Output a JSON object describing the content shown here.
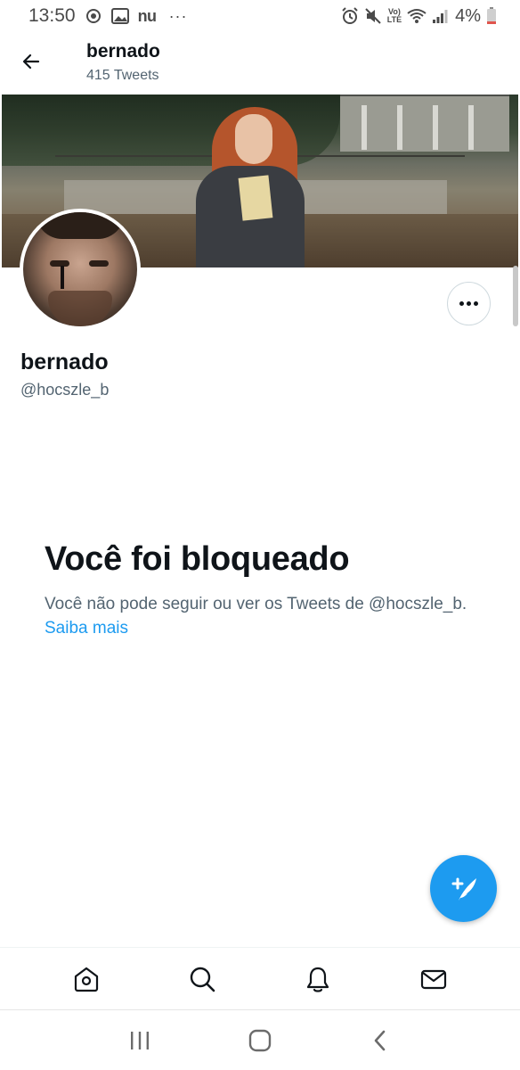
{
  "status_bar": {
    "time": "13:50",
    "carrier_text": "nu",
    "more_indicator": "···",
    "lte_top": "Vo)",
    "lte_bottom": "LTE",
    "battery_percent": "4%",
    "icons": [
      "sync-icon",
      "image-icon",
      "alarm-icon",
      "mute-icon",
      "wifi-icon",
      "signal-icon",
      "battery-icon"
    ]
  },
  "header": {
    "title": "bernado",
    "subtitle": "415 Tweets"
  },
  "profile": {
    "name": "bernado",
    "handle": "@hocszle_b"
  },
  "blocked": {
    "title": "Você foi bloqueado",
    "description": "Você não pode seguir ou ver os Tweets de @hocszle_b.",
    "link": "Saiba mais"
  },
  "bottom_nav": {
    "items": [
      "home-icon",
      "search-icon",
      "notifications-icon",
      "messages-icon"
    ]
  },
  "system_nav": {
    "items": [
      "recents-icon",
      "home-icon",
      "back-icon"
    ]
  },
  "colors": {
    "accent": "#1d9bf0",
    "text_primary": "#0f1419",
    "text_secondary": "#536471",
    "border": "#cfd9de"
  }
}
